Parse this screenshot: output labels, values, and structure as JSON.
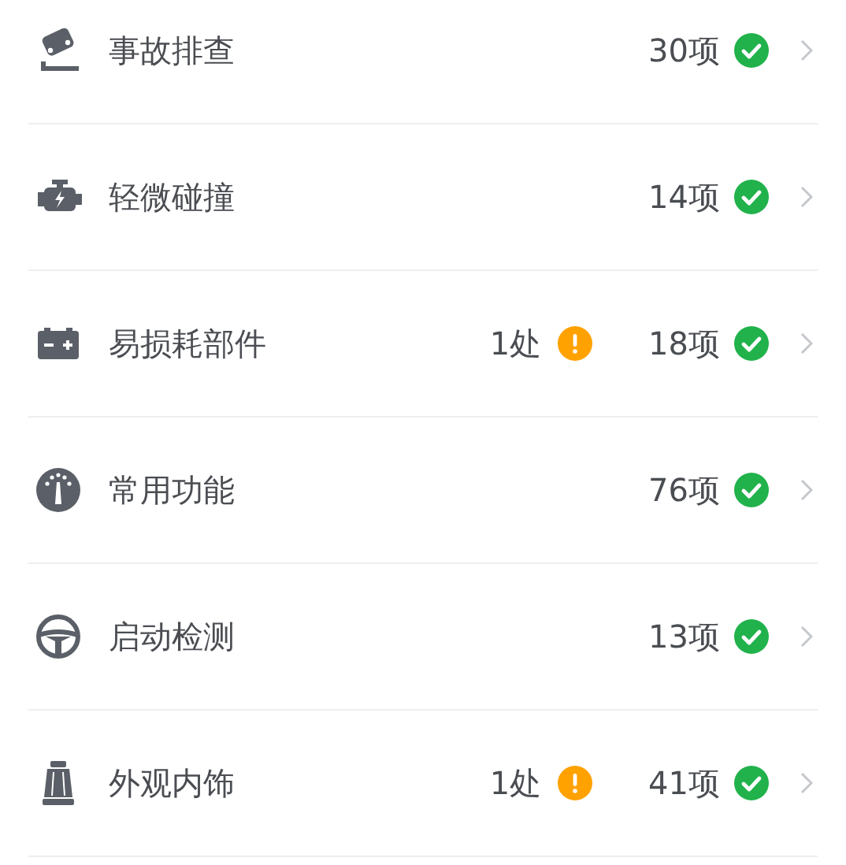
{
  "items": [
    {
      "label": "事故排查",
      "count": "30项",
      "passed": true
    },
    {
      "label": "轻微碰撞",
      "count": "14项",
      "passed": true
    },
    {
      "label": "易损耗部件",
      "issues": "1处",
      "count": "18项",
      "passed": true
    },
    {
      "label": "常用功能",
      "count": "76项",
      "passed": true
    },
    {
      "label": "启动检测",
      "count": "13项",
      "passed": true
    },
    {
      "label": "外观内饰",
      "issues": "1处",
      "count": "41项",
      "passed": true
    }
  ]
}
